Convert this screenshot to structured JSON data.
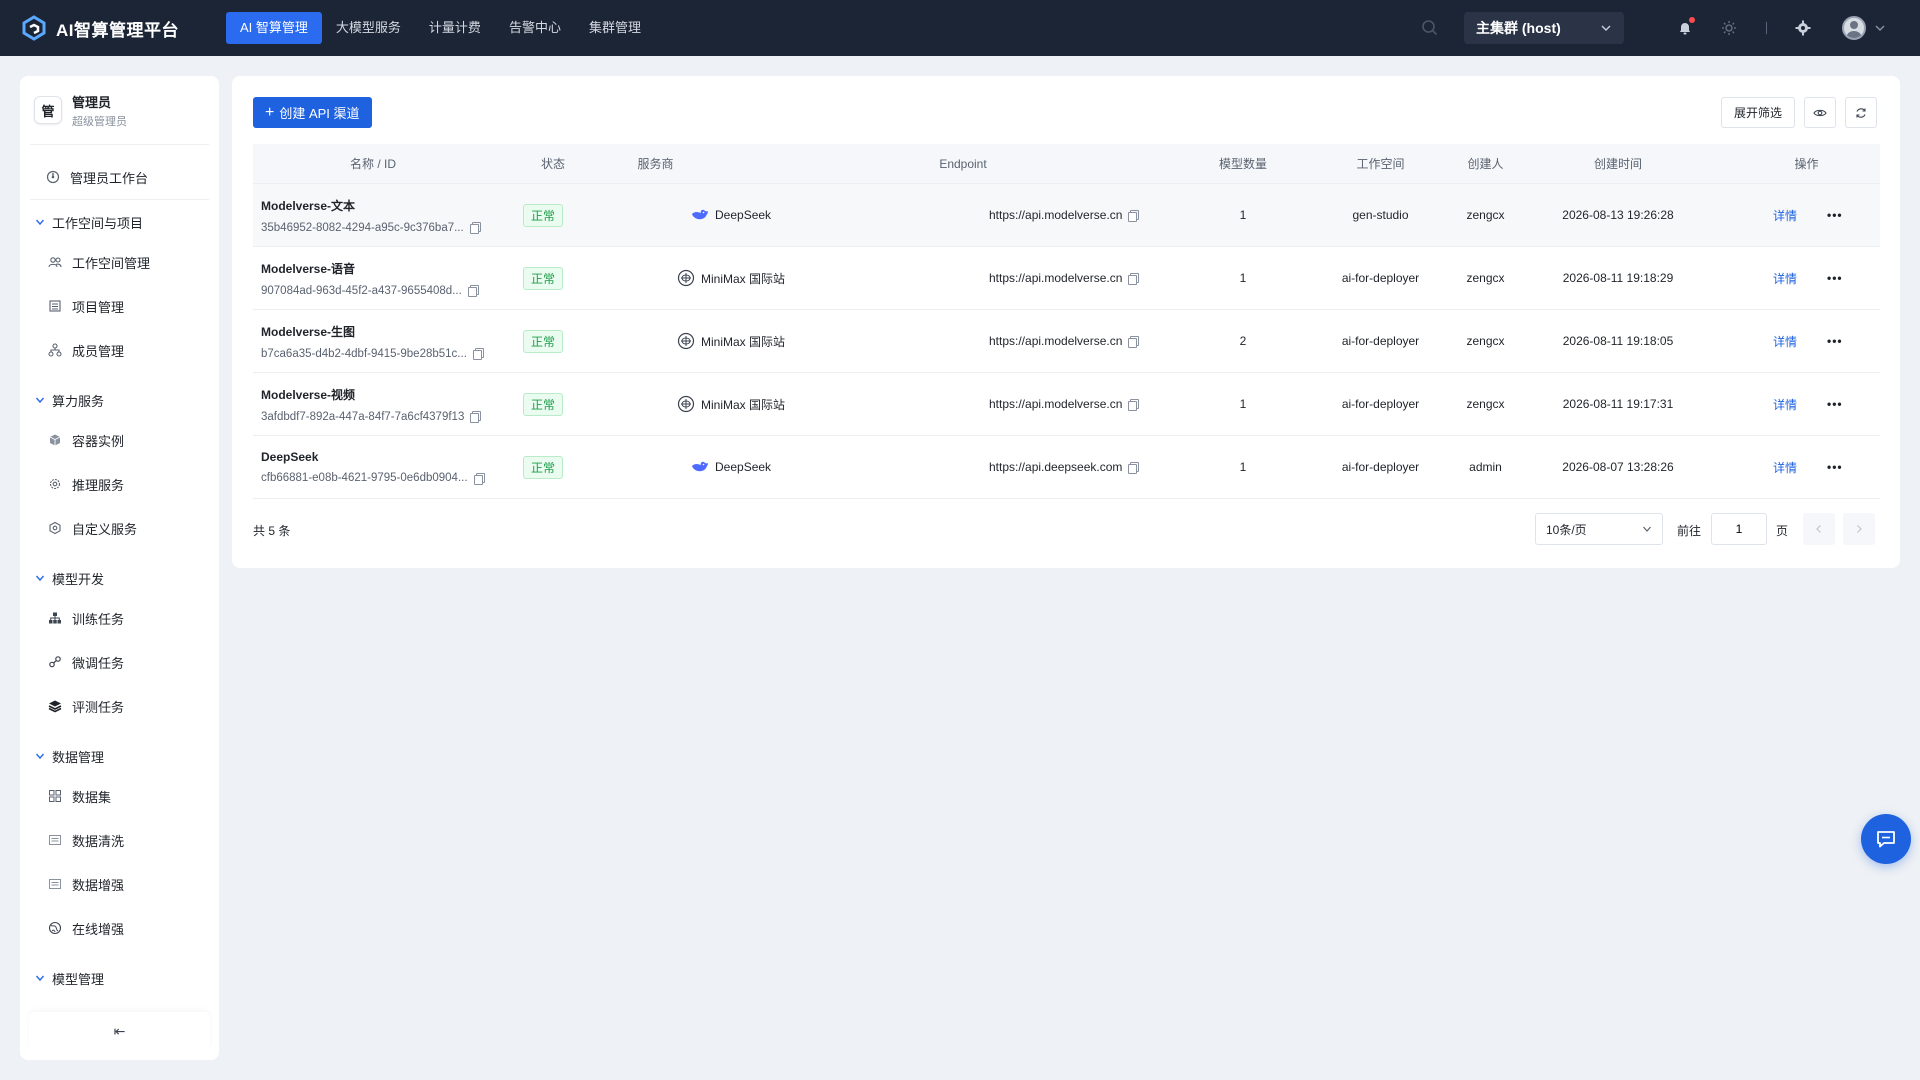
{
  "brand": {
    "title": "AI智算管理平台"
  },
  "nav": [
    {
      "label": "AI 智算管理",
      "active": true
    },
    {
      "label": "大模型服务",
      "active": false
    },
    {
      "label": "计量计费",
      "active": false
    },
    {
      "label": "告警中心",
      "active": false
    },
    {
      "label": "集群管理",
      "active": false
    }
  ],
  "cluster": {
    "label": "主集群 (host)"
  },
  "user": {
    "avatar_char": "管",
    "name": "管理员",
    "role": "超级管理员"
  },
  "sidebar": {
    "workbench": "管理员工作台",
    "groups": [
      {
        "label": "工作空间与项目",
        "items": [
          "工作空间管理",
          "项目管理",
          "成员管理"
        ]
      },
      {
        "label": "算力服务",
        "items": [
          "容器实例",
          "推理服务",
          "自定义服务"
        ]
      },
      {
        "label": "模型开发",
        "items": [
          "训练任务",
          "微调任务",
          "评测任务"
        ]
      },
      {
        "label": "数据管理",
        "items": [
          "数据集",
          "数据清洗",
          "数据增强",
          "在线增强"
        ]
      },
      {
        "label": "模型管理",
        "items": []
      }
    ],
    "collapse_glyph": "⇤"
  },
  "toolbar": {
    "create_label": "创建 API 渠道",
    "filter_label": "展开筛选"
  },
  "table": {
    "headers": {
      "name": "名称 / ID",
      "status": "状态",
      "provider": "服务商",
      "endpoint": "Endpoint",
      "count": "模型数量",
      "workspace": "工作空间",
      "creator": "创建人",
      "time": "创建时间",
      "action": "操作"
    },
    "rows": [
      {
        "name": "Modelverse-文本",
        "id": "35b46952-8082-4294-a95c-9c376ba7...",
        "status": "正常",
        "provider": "DeepSeek",
        "provider_logo": "deepseek-logo",
        "endpoint": "https://api.modelverse.cn",
        "count": "1",
        "workspace": "gen-studio",
        "creator": "zengcx",
        "time": "2026-08-13 19:26:28",
        "action": "详情"
      },
      {
        "name": "Modelverse-语音",
        "id": "907084ad-963d-45f2-a437-9655408d...",
        "status": "正常",
        "provider": "MiniMax 国际站",
        "provider_logo": "minimax-logo",
        "endpoint": "https://api.modelverse.cn",
        "count": "1",
        "workspace": "ai-for-deployer",
        "creator": "zengcx",
        "time": "2026-08-11 19:18:29",
        "action": "详情"
      },
      {
        "name": "Modelverse-生图",
        "id": "b7ca6a35-d4b2-4dbf-9415-9be28b51c...",
        "status": "正常",
        "provider": "MiniMax 国际站",
        "provider_logo": "minimax-logo",
        "endpoint": "https://api.modelverse.cn",
        "count": "2",
        "workspace": "ai-for-deployer",
        "creator": "zengcx",
        "time": "2026-08-11 19:18:05",
        "action": "详情"
      },
      {
        "name": "Modelverse-视频",
        "id": "3afdbdf7-892a-447a-84f7-7a6cf4379f13",
        "status": "正常",
        "provider": "MiniMax 国际站",
        "provider_logo": "minimax-logo",
        "endpoint": "https://api.modelverse.cn",
        "count": "1",
        "workspace": "ai-for-deployer",
        "creator": "zengcx",
        "time": "2026-08-11 19:17:31",
        "action": "详情"
      },
      {
        "name": "DeepSeek",
        "id": "cfb66881-e08b-4621-9795-0e6db0904...",
        "status": "正常",
        "provider": "DeepSeek",
        "provider_logo": "deepseek-logo",
        "endpoint": "https://api.deepseek.com",
        "count": "1",
        "workspace": "ai-for-deployer",
        "creator": "admin",
        "time": "2026-08-07 13:28:26",
        "action": "详情"
      }
    ]
  },
  "pagination": {
    "total": "共 5 条",
    "page_size": "10条/页",
    "goto_label": "前往",
    "page_value": "1",
    "page_unit": "页"
  },
  "colors": {
    "topbar": "#1c2535",
    "primary": "#1f62e0",
    "success": "#1e9e4a",
    "page_bg": "#eef1f5"
  }
}
